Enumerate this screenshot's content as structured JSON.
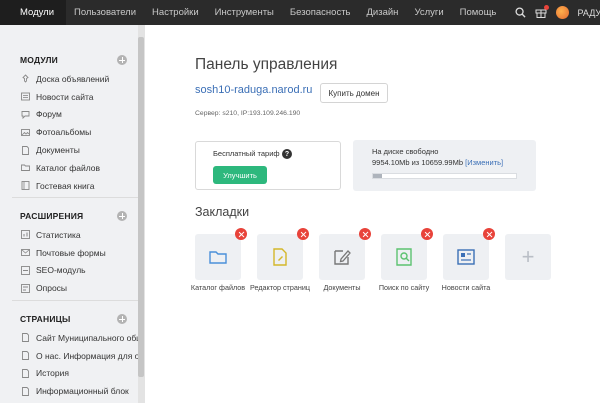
{
  "topnav": {
    "items": [
      "Модули",
      "Пользователи",
      "Настройки",
      "Инструменты",
      "Безопасность",
      "Дизайн",
      "Услуги",
      "Помощь"
    ],
    "user_name": "РАДУГ"
  },
  "sidebar": {
    "sections": [
      {
        "title": "МОДУЛИ",
        "items": [
          "Доска объявлений",
          "Новости сайта",
          "Форум",
          "Фотоальбомы",
          "Документы",
          "Каталог файлов",
          "Гостевая книга"
        ]
      },
      {
        "title": "РАСШИРЕНИЯ",
        "items": [
          "Статистика",
          "Почтовые формы",
          "SEO-модуль",
          "Опросы"
        ]
      },
      {
        "title": "СТРАНИЦЫ",
        "items": [
          "Сайт Муниципального общес",
          "О нас. Информация для обра",
          "История",
          "Информационный блок"
        ]
      }
    ]
  },
  "main": {
    "title": "Панель управления",
    "site_link": "sosh10-raduga.narod.ru",
    "buy_domain": "Купить домен",
    "server": "Сервер: s210, IP:193.109.246.190",
    "tariff": {
      "label": "Бесплатный тариф",
      "help": "?",
      "upgrade": "Улучшить"
    },
    "disk": {
      "title": "На диске свободно",
      "free": "9954.10Mb из 10659.99Mb",
      "change": "[Изменить]",
      "used_fraction": 0.066
    },
    "bookmarks": {
      "title": "Закладки",
      "items": [
        "Каталог файлов",
        "Редактор страниц",
        "Документы",
        "Поиск по сайту",
        "Новости сайта"
      ],
      "add": "+"
    }
  },
  "colors": {
    "accent_green": "#2db87d",
    "link_blue": "#3b6fb6",
    "delete_red": "#e8433a",
    "topbar": "#2b2b2b"
  }
}
